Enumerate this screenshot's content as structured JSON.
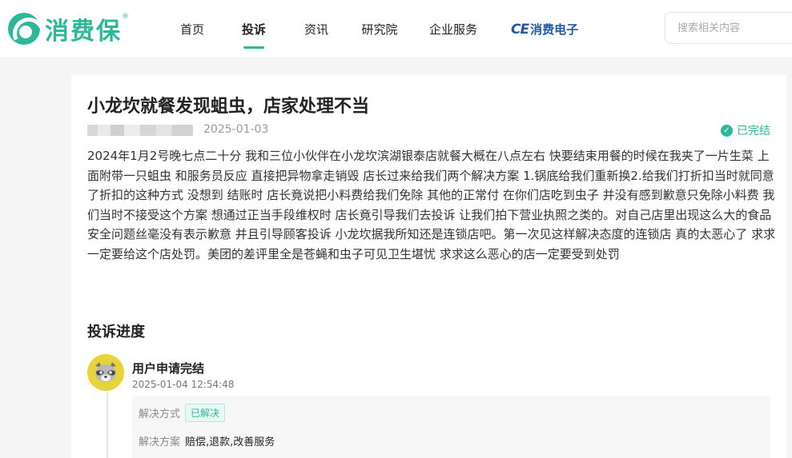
{
  "brand": {
    "name": "消费保",
    "reg": "®"
  },
  "nav": {
    "items": [
      {
        "label": "首页",
        "active": false
      },
      {
        "label": "投诉",
        "active": true
      },
      {
        "label": "资讯",
        "active": false
      },
      {
        "label": "研究院",
        "active": false
      },
      {
        "label": "企业服务",
        "active": false
      }
    ],
    "ce_logo": {
      "mark": "CE",
      "text": "消费电子"
    }
  },
  "search": {
    "placeholder": "搜索相关内容"
  },
  "complaint": {
    "title": "小龙坎就餐发现蛆虫，店家处理不当",
    "date": "2025-01-03",
    "status": "已完结",
    "content": "2024年1月2号晚七点二十分 我和三位小伙伴在小龙坎滨湖银泰店就餐大概在八点左右 快要结束用餐的时候在我夹了一片生菜 上面附带一只蛆虫 和服务员反应 直接把异物拿走销毁 店长过来给我们两个解决方案 1.锅底给我们重新换2.给我们打折扣当时就同意了折扣的这种方式 没想到 结账时 店长竟说把小料费给我们免除 其他的正常付 在你们店吃到虫子 并没有感到歉意只免除小料费 我们当时不接受这个方案 想通过正当手段维权时 店长竟引导我们去投诉 让我们拍下营业执照之类的。对自己店里出现这么大的食品安全问题丝毫没有表示歉意 并且引导顾客投诉 小龙坎据我所知还是连锁店吧。第一次见这样解决态度的连锁店 真的太恶心了 求求一定要给这个店处罚。美团的差评里全是苍蝇和虫子可见卫生堪忧 求求这么恶心的店一定要受到处罚"
  },
  "progress": {
    "section_title": "投诉进度",
    "step": {
      "title": "用户申请完结",
      "time": "2025-01-04 12:54:48",
      "method_label": "解决方式",
      "method_value": "已解决",
      "plan_label": "解决方案",
      "plan_value": "赔偿,退款,改善服务"
    }
  },
  "colors": {
    "accent": "#2eb89a",
    "ce_blue": "#1f5aa6",
    "avatar_bg": "#e8d43a"
  }
}
